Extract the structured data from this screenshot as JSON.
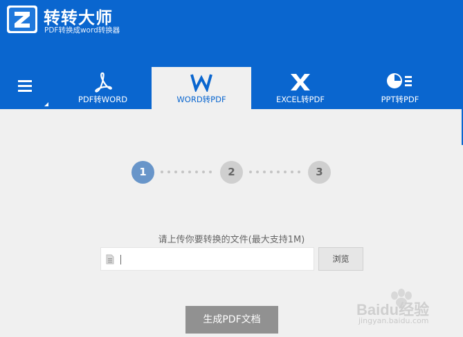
{
  "app": {
    "title": "转转大师",
    "subtitle": "PDF转换成word转换器",
    "accent_color": "#0a66cf"
  },
  "menu": {
    "icon": "hamburger-menu-icon"
  },
  "tabs": [
    {
      "label": "PDF转WORD",
      "icon": "acrobat-icon",
      "active": false
    },
    {
      "label": "WORD转PDF",
      "icon": "word-icon",
      "active": true
    },
    {
      "label": "EXCEL转PDF",
      "icon": "excel-icon",
      "active": false
    },
    {
      "label": "PPT转PDF",
      "icon": "powerpoint-icon",
      "active": false
    }
  ],
  "steps": [
    {
      "number": "1",
      "active": true
    },
    {
      "number": "2",
      "active": false
    },
    {
      "number": "3",
      "active": false
    }
  ],
  "upload": {
    "prompt": "请上传你要转换的文件(最大支持1M)",
    "value": "",
    "browse_label": "浏览"
  },
  "generate_label": "生成PDF文档",
  "watermark": {
    "brand": "Baidu经验",
    "url": "jingyan.baidu.com"
  }
}
